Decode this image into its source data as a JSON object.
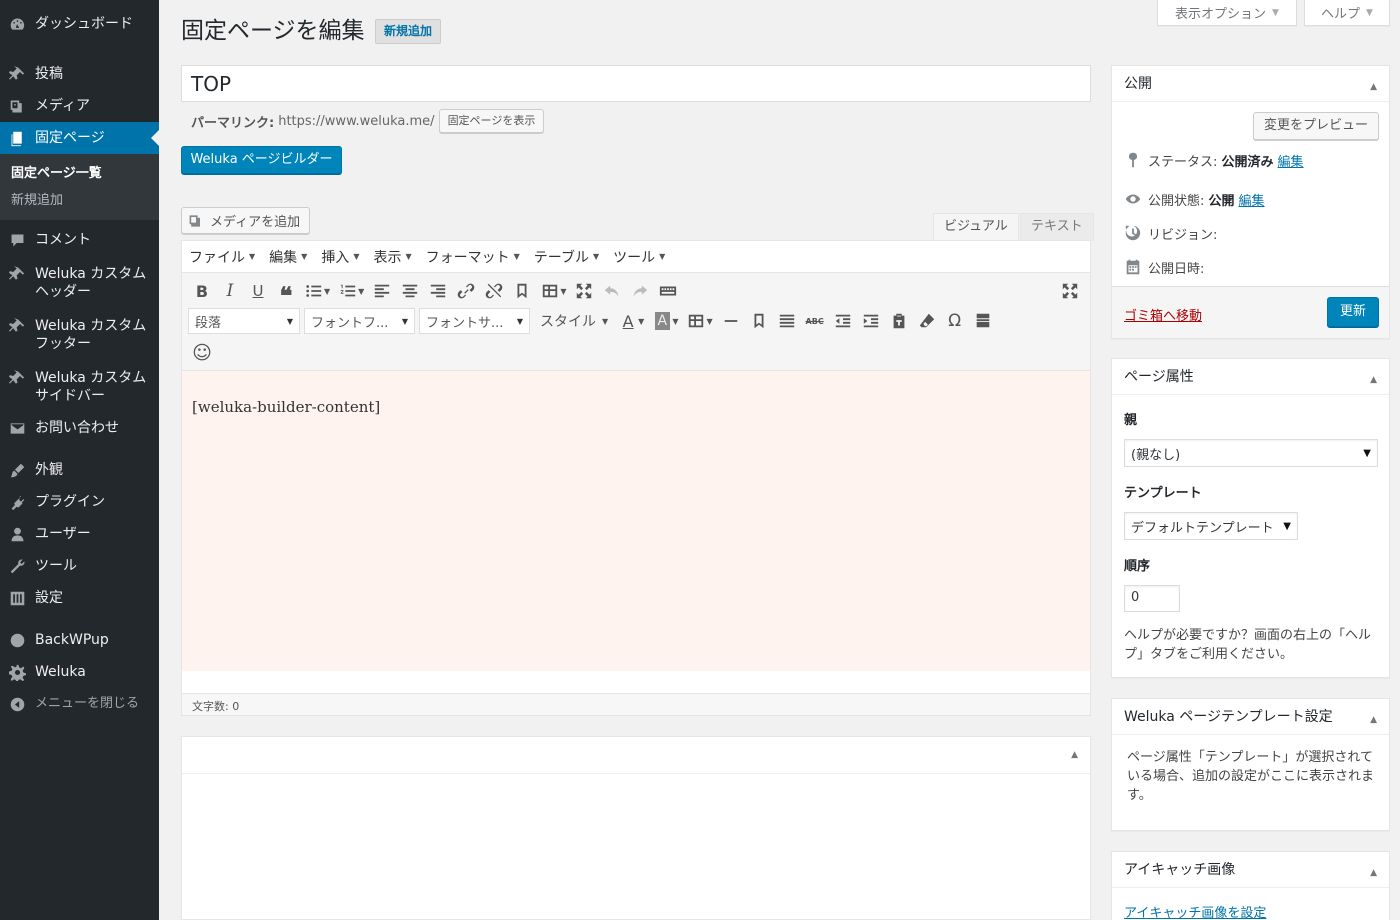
{
  "sidebar": {
    "dashboard": "ダッシュボード",
    "posts": "投稿",
    "media": "メディア",
    "pages": "固定ページ",
    "pages_sub": [
      "固定ページ一覧",
      "新規追加"
    ],
    "comments": "コメント",
    "custom_header": "Weluka カスタムヘッダー",
    "custom_footer": "Weluka カスタムフッター",
    "custom_sidebar": "Weluka カスタムサイドバー",
    "contact": "お問い合わせ",
    "appearance": "外観",
    "plugins": "プラグイン",
    "users": "ユーザー",
    "tools": "ツール",
    "settings": "設定",
    "backwpup": "BackWPup",
    "weluka": "Weluka",
    "collapse": "メニューを閉じる"
  },
  "screen_meta": {
    "options": "表示オプション",
    "help": "ヘルプ"
  },
  "header": {
    "title": "固定ページを編集",
    "add_new": "新規追加"
  },
  "post": {
    "title": "TOP",
    "permalink_label": "パーマリンク:",
    "permalink_url": "https://www.weluka.me/",
    "view_page": "固定ページを表示",
    "builder_button": "Weluka ページビルダー"
  },
  "editor": {
    "add_media": "メディアを追加",
    "tab_visual": "ビジュアル",
    "tab_text": "テキスト",
    "menus": [
      "ファイル",
      "編集",
      "挿入",
      "表示",
      "フォーマット",
      "テーブル",
      "ツール"
    ],
    "format_select": "段落",
    "font_family": "フォントフ...",
    "font_size": "フォントサ...",
    "styles": "スタイル",
    "content": "[weluka-builder-content]",
    "word_count": "文字数: 0"
  },
  "publish": {
    "title": "公開",
    "preview": "変更をプレビュー",
    "status_label": "ステータス:",
    "status_value": "公開済み",
    "edit": "編集",
    "visibility_label": "公開状態:",
    "visibility_value": "公開",
    "revisions": "リビジョン:",
    "date": "公開日時:",
    "trash": "ゴミ箱へ移動",
    "update": "更新"
  },
  "attributes": {
    "title": "ページ属性",
    "parent_label": "親",
    "parent_value": "(親なし)",
    "template_label": "テンプレート",
    "template_value": "デフォルトテンプレート",
    "order_label": "順序",
    "order_value": "0",
    "help": "ヘルプが必要ですか？画面の右上の「ヘルプ」タブをご利用ください。"
  },
  "template_settings": {
    "title": "Weluka ページテンプレート設定",
    "text": "ページ属性「テンプレート」が選択されている場合、追加の設定がここに表示されます。"
  },
  "featured_image": {
    "title": "アイキャッチ画像",
    "set": "アイキャッチ画像を設定"
  }
}
